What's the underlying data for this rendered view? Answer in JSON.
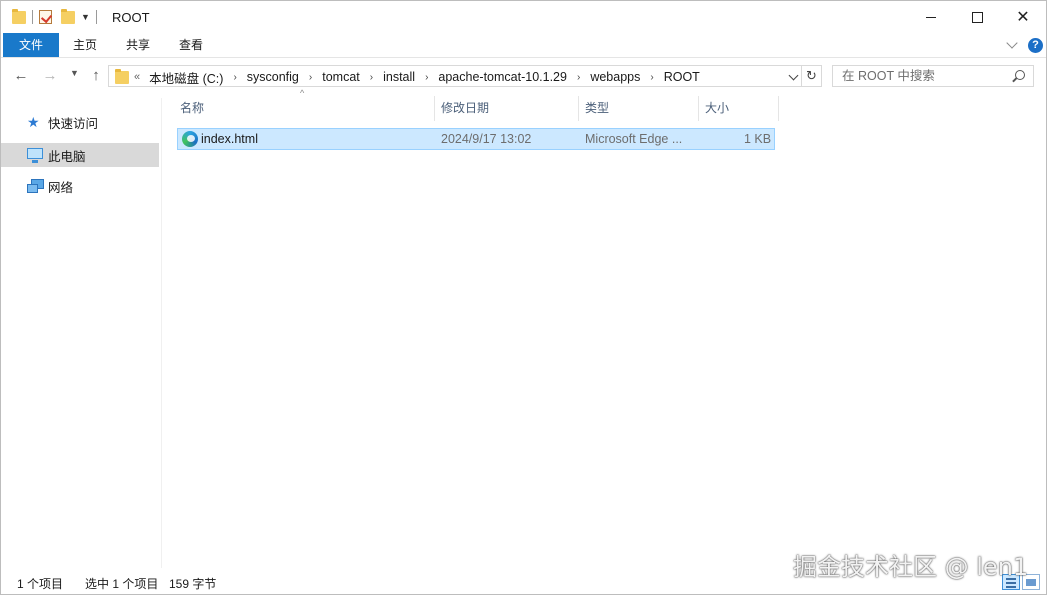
{
  "window": {
    "title": "ROOT",
    "controls": {
      "minimize": "minimize",
      "maximize": "maximize",
      "close": "✕"
    }
  },
  "ribbon": {
    "tabs": [
      "文件",
      "主页",
      "共享",
      "查看"
    ],
    "help": "?"
  },
  "nav": {
    "back": "←",
    "forward": "→",
    "up": "↑",
    "overflow": "«",
    "breadcrumbs": [
      "本地磁盘 (C:)",
      "sysconfig",
      "tomcat",
      "install",
      "apache-tomcat-10.1.29",
      "webapps",
      "ROOT"
    ],
    "refresh": "↻",
    "search_placeholder": "在 ROOT 中搜索"
  },
  "sidebar": {
    "items": [
      {
        "label": "快速访问",
        "icon": "star-icon",
        "selected": false
      },
      {
        "label": "此电脑",
        "icon": "computer-icon",
        "selected": true
      },
      {
        "label": "网络",
        "icon": "network-icon",
        "selected": false
      }
    ]
  },
  "files": {
    "columns": [
      "名称",
      "修改日期",
      "类型",
      "大小"
    ],
    "sort_indicator": "^",
    "rows": [
      {
        "name": "index.html",
        "modified": "2024/9/17 13:02",
        "type": "Microsoft Edge ...",
        "size": "1 KB",
        "icon": "edge-html-icon",
        "selected": true
      }
    ]
  },
  "status": {
    "item_count": "1 个项目",
    "selection": "选中 1 个项目",
    "selection_size": "159 字节"
  },
  "watermark": "掘金技术社区 @ len1",
  "colors": {
    "accent": "#1979ca",
    "selection_bg": "#cce8ff",
    "selection_border": "#99d1ff",
    "sidebar_selected": "#d9d9d9"
  }
}
